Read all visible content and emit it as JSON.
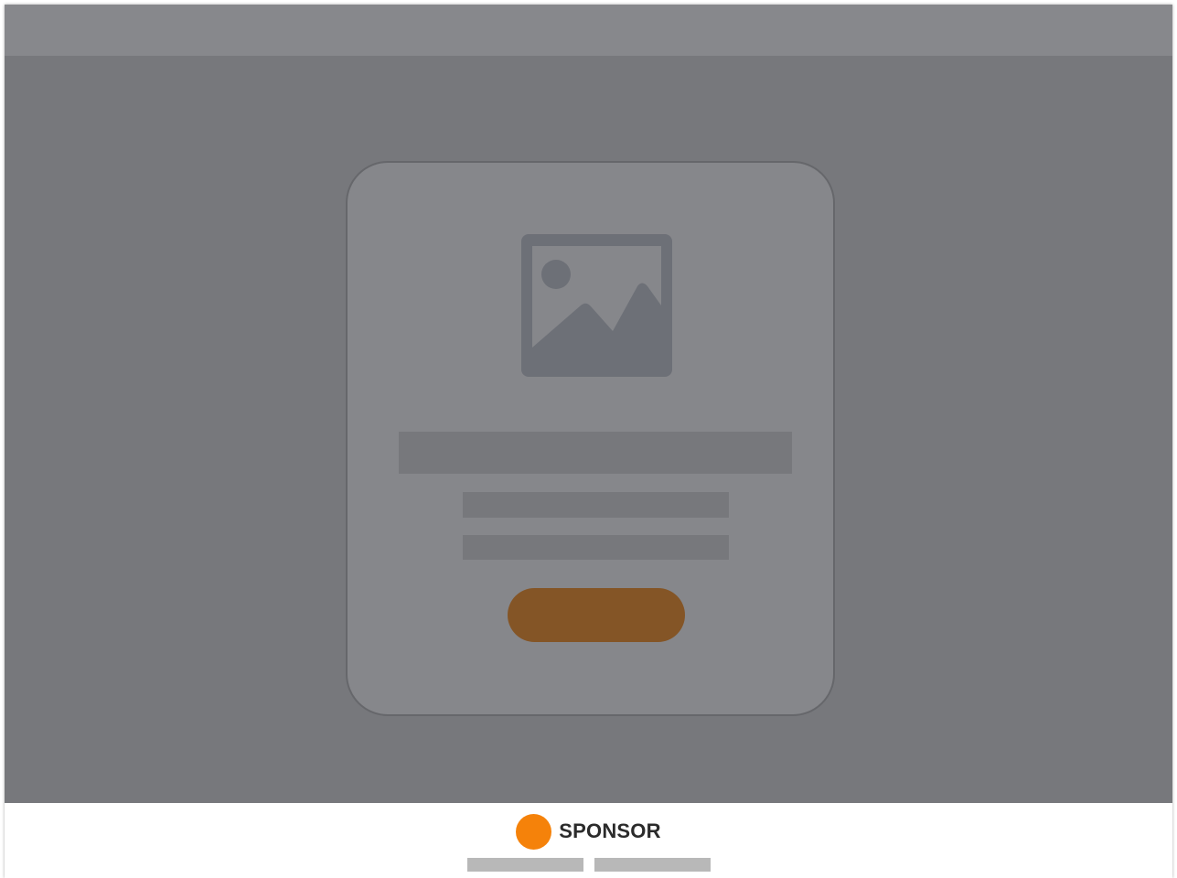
{
  "ad_card": {
    "image_icon": "image-placeholder-icon",
    "headline": "",
    "body_line_1": "",
    "body_line_2": "",
    "cta_label": ""
  },
  "sponsor": {
    "label": "SPONSOR",
    "logo_icon": "orange-circle-logo",
    "logo_color": "#f5820a",
    "links": [
      "",
      ""
    ]
  },
  "colors": {
    "overlay": "#77787c",
    "card": "#86878b",
    "cta": "#845526"
  }
}
